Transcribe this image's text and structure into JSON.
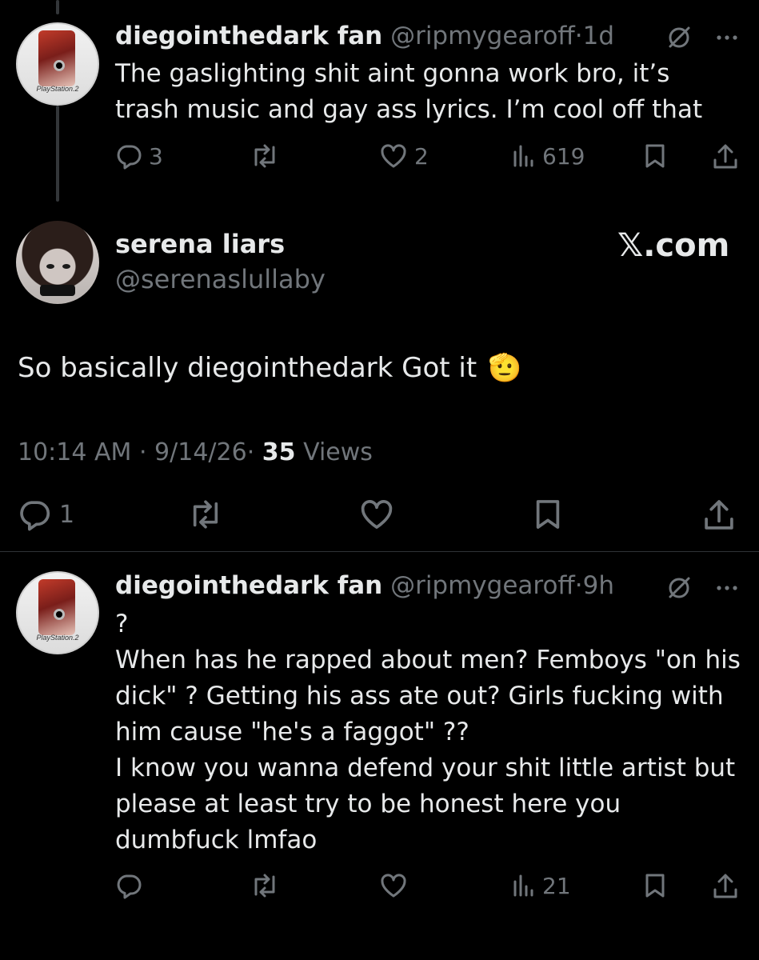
{
  "tweet1": {
    "name": "diegointhedark fan",
    "handle": "@ripmygearoff",
    "separator": "·",
    "time": "1d",
    "text": "The gaslighting shit aint gonna work bro, it’s\ntrash music and gay ass lyrics. I’m cool off that",
    "avatar_label": "PlayStation.2",
    "replies": "3",
    "reposts": "",
    "likes": "2",
    "views": "619"
  },
  "main": {
    "name": "serena liars",
    "handle": "@serenaslullaby",
    "brand": "𝕏.com",
    "text": "So basically diegointhedark Got it",
    "emoji": "🫡",
    "time": "10:14 AM",
    "date": "9/14/26",
    "separator": "·",
    "views_count": "35",
    "views_label": "Views",
    "replies": "1"
  },
  "tweet2": {
    "name": "diegointhedark fan",
    "handle": "@ripmygearoff",
    "separator": "·",
    "time": "9h",
    "text": "?\nWhen has he rapped about men? Femboys \"on his\ndick\" ? Getting his ass ate out? Girls fucking with\nhim cause \"he's a faggot\" ??\nI know you wanna defend your shit little artist but\nplease at least try to be honest here you\ndumbfuck lmfao",
    "avatar_label": "PlayStation.2",
    "views": "21"
  },
  "icons": {
    "reply": "reply-icon",
    "repost": "repost-icon",
    "like": "heart-icon",
    "views": "views-icon",
    "bookmark": "bookmark-icon",
    "share": "share-icon",
    "grok": "grok-icon",
    "more": "more-icon"
  },
  "colors": {
    "background": "#000000",
    "text_primary": "#e7e9ea",
    "text_secondary": "#71767b",
    "divider": "#2f3336"
  }
}
